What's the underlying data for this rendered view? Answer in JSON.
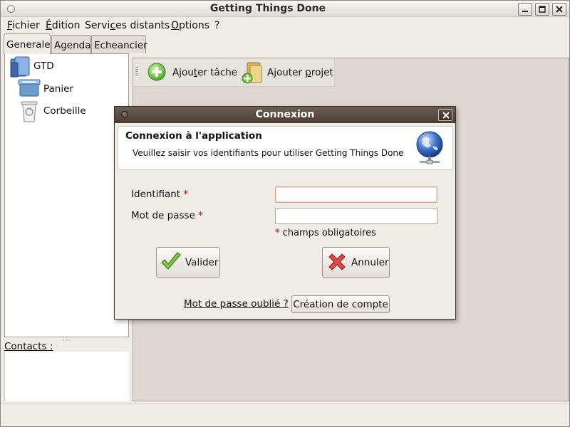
{
  "window": {
    "title": "Getting Things Done"
  },
  "menu": {
    "items": [
      {
        "first": "F",
        "rest": "ichier"
      },
      {
        "first": "É",
        "rest": "dition"
      },
      {
        "pre": "Servi",
        "first": "c",
        "rest": "es distants"
      },
      {
        "first": "O",
        "rest": "ptions"
      },
      {
        "label": "?"
      }
    ]
  },
  "tabs": [
    "Generale",
    "Agenda",
    "Echeancier"
  ],
  "tree": {
    "items": [
      {
        "label": "GTD",
        "icon": "folder-icon"
      },
      {
        "label": "Panier",
        "icon": "basket-icon"
      },
      {
        "label": "Corbeille",
        "icon": "trash-icon"
      }
    ]
  },
  "contacts": {
    "label": "Contacts :"
  },
  "toolbar": {
    "add_task_pre": "Ajou",
    "add_task_mn": "t",
    "add_task_post": "er tâche",
    "add_project_pre": "Ajouter ",
    "add_project_mn": "p",
    "add_project_post": "rojet"
  },
  "dialog": {
    "title": "Connexion",
    "header_title": "Connexion à l'application",
    "header_subtitle": "Veuillez saisir vos identifiants pour utiliser Getting Things Done",
    "identifiant_label": "Identifiant",
    "password_label": "Mot de passe",
    "required_mark": "*",
    "identifiant_value": "",
    "password_value": "",
    "required_note": "champs obligatoires",
    "validate_label": "Valider",
    "cancel_label": "Annuler",
    "forgot_label": "Mot de passe oublié ?",
    "create_account_label": "Création de compte"
  },
  "colors": {
    "required": "#cc0000",
    "dialog_titlebar": "#4a3d34"
  }
}
